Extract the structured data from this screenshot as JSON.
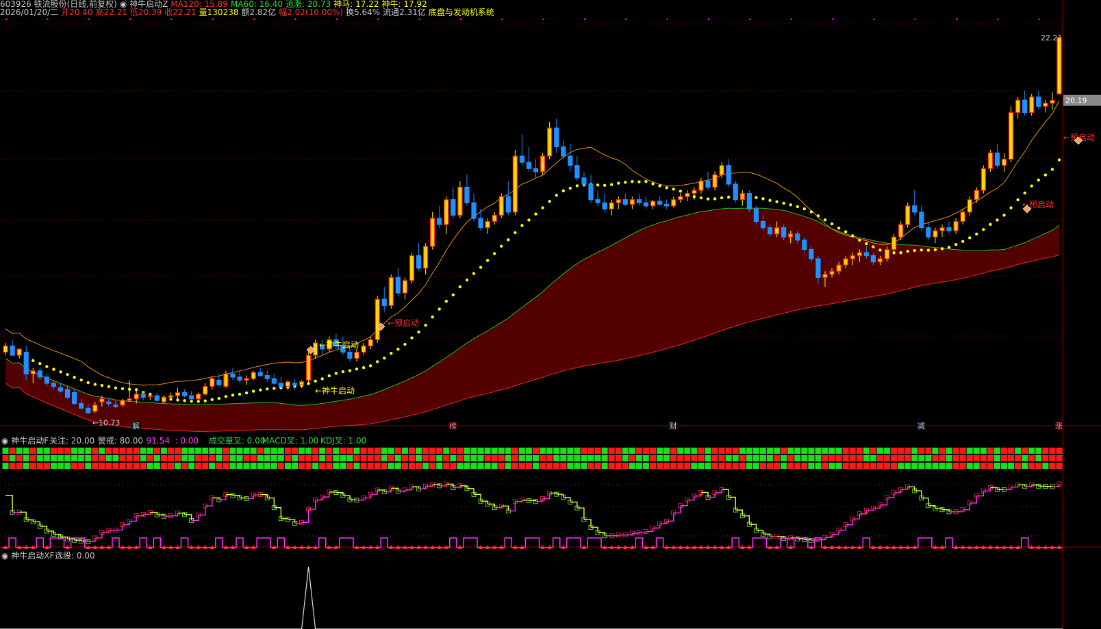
{
  "header": {
    "line1": [
      {
        "text": "603926 铁流股份(日线,前复权)",
        "color": "#c8c8c8"
      },
      {
        "text": "◉ 神牛启动Z",
        "color": "#c8c8c8"
      },
      {
        "text": "MA120: 15.89",
        "color": "#ff3333"
      },
      {
        "text": "MA60: 16.40",
        "color": "#33dd33"
      },
      {
        "text": "追涨: 20.73",
        "color": "#33dd33"
      },
      {
        "text": "神马: 17.22",
        "color": "#ffff00"
      },
      {
        "text": "神牛: 17.92",
        "color": "#ffff00"
      }
    ],
    "line2": [
      {
        "text": "2026/01/20/二",
        "color": "#c8c8c8"
      },
      {
        "text": "开20.40",
        "color": "#ff3333"
      },
      {
        "text": "高22.21",
        "color": "#ff3333"
      },
      {
        "text": "低20.39",
        "color": "#ff3333"
      },
      {
        "text": "收22.21",
        "color": "#ff3333"
      },
      {
        "text": "量130238",
        "color": "#ffff00"
      },
      {
        "text": "额2.82亿",
        "color": "#c8c8c8"
      },
      {
        "text": "幅2.02(10.00%)",
        "color": "#ff3333"
      },
      {
        "text": "换5.64%",
        "color": "#c8c8c8"
      },
      {
        "text": "流通2.31亿",
        "color": "#c8c8c8"
      },
      {
        "text": "底盘与发动机系统",
        "color": "#ffff00"
      }
    ]
  },
  "colors": {
    "up_body": "#ff2020",
    "up_fill": "#ffd700",
    "down": "#1e90ff",
    "grid": "#6b0000",
    "ma60": "#22c022",
    "ma120": "#ff2020",
    "band": "#520000",
    "orange": "#e8901a",
    "dots": "#ffff00",
    "wick": "#ffff00"
  },
  "chart_data": {
    "type": "candlestick",
    "price_labels": [
      "22.21",
      "20.19"
    ],
    "high_label": "22.21",
    "low_label": "←10.73",
    "annotations": [
      {
        "text": "←神牛启动",
        "color": "#ffff00",
        "at": "x≈16.5"
      },
      {
        "text": "←预启动",
        "color": "#ff3030",
        "at": "x≈44"
      },
      {
        "text": "←预启动",
        "color": "#ff3030",
        "at": "x≈145"
      },
      {
        "text": "←预启动",
        "color": "#ff3030",
        "at": "x≈152"
      },
      {
        "text": "←神牛启动",
        "color": "#ffff00",
        "at": "x≈44"
      }
    ],
    "event_marks": [
      {
        "text": "解",
        "color": "#7fd7ff",
        "i": 19
      },
      {
        "text": "榜",
        "color": "#ff8080",
        "i": 65
      },
      {
        "text": "财",
        "color": "#7fd7ff",
        "i": 97
      },
      {
        "text": "减",
        "color": "#7fd7ff",
        "i": 133
      },
      {
        "text": "涨",
        "color": "#ff8080",
        "i": 153
      }
    ],
    "ohlc": [
      [
        12.1,
        12.4,
        12.0,
        12.3
      ],
      [
        12.3,
        12.5,
        12.0,
        12.0
      ],
      [
        12.0,
        12.2,
        11.9,
        12.2
      ],
      [
        12.1,
        12.3,
        11.2,
        11.4
      ],
      [
        11.4,
        11.6,
        11.1,
        11.5
      ],
      [
        11.5,
        11.6,
        11.2,
        11.3
      ],
      [
        11.3,
        11.4,
        11.0,
        11.1
      ],
      [
        11.1,
        11.2,
        10.9,
        11.0
      ],
      [
        10.95,
        11.1,
        10.8,
        10.85
      ],
      [
        10.9,
        11.0,
        10.6,
        10.65
      ],
      [
        10.8,
        10.9,
        10.4,
        10.45
      ],
      [
        10.45,
        10.6,
        10.25,
        10.3
      ],
      [
        10.3,
        10.45,
        10.1,
        10.15
      ],
      [
        10.2,
        10.5,
        10.15,
        10.4
      ],
      [
        10.5,
        10.7,
        10.35,
        10.6
      ],
      [
        10.5,
        10.6,
        10.35,
        10.45
      ],
      [
        10.4,
        10.55,
        10.3,
        10.35
      ],
      [
        10.4,
        10.6,
        10.35,
        10.55
      ],
      [
        10.55,
        11.2,
        10.5,
        10.6
      ],
      [
        10.6,
        10.9,
        10.45,
        10.75
      ],
      [
        10.75,
        10.85,
        10.55,
        10.65
      ],
      [
        10.7,
        10.8,
        10.55,
        10.7
      ],
      [
        10.7,
        10.8,
        10.5,
        10.55
      ],
      [
        10.5,
        10.7,
        10.45,
        10.65
      ],
      [
        10.65,
        10.8,
        10.55,
        10.7
      ],
      [
        10.7,
        10.95,
        10.6,
        10.8
      ],
      [
        10.8,
        10.9,
        10.65,
        10.7
      ],
      [
        10.7,
        10.85,
        10.55,
        10.6
      ],
      [
        10.6,
        10.8,
        10.5,
        10.75
      ],
      [
        10.75,
        11.1,
        10.7,
        11.0
      ],
      [
        11.0,
        11.3,
        10.9,
        11.25
      ],
      [
        11.2,
        11.4,
        11.0,
        11.05
      ],
      [
        11.0,
        11.5,
        10.95,
        11.4
      ],
      [
        11.4,
        11.6,
        11.2,
        11.3
      ],
      [
        11.3,
        11.5,
        11.1,
        11.2
      ],
      [
        11.2,
        11.35,
        11.05,
        11.25
      ],
      [
        11.25,
        11.5,
        11.2,
        11.45
      ],
      [
        11.45,
        11.6,
        11.3,
        11.35
      ],
      [
        11.35,
        11.5,
        11.15,
        11.25
      ],
      [
        11.25,
        11.4,
        11.05,
        11.1
      ],
      [
        11.1,
        11.3,
        10.95,
        11.0
      ],
      [
        11.0,
        11.2,
        10.9,
        11.15
      ],
      [
        11.1,
        11.25,
        10.9,
        11.05
      ],
      [
        11.05,
        11.2,
        10.95,
        11.15
      ],
      [
        11.2,
        12.1,
        11.1,
        12.0
      ],
      [
        12.0,
        12.5,
        11.9,
        12.4
      ],
      [
        12.3,
        12.5,
        12.0,
        12.2
      ],
      [
        12.2,
        12.6,
        12.1,
        12.5
      ],
      [
        12.5,
        12.7,
        12.2,
        12.3
      ],
      [
        12.3,
        12.6,
        12.0,
        12.1
      ],
      [
        12.1,
        12.3,
        11.8,
        11.9
      ],
      [
        11.9,
        12.2,
        11.8,
        12.1
      ],
      [
        12.1,
        12.4,
        12.0,
        12.3
      ],
      [
        12.3,
        12.6,
        12.2,
        12.5
      ],
      [
        12.5,
        13.9,
        12.4,
        13.8
      ],
      [
        13.8,
        14.2,
        13.4,
        13.6
      ],
      [
        13.6,
        14.6,
        13.5,
        14.5
      ],
      [
        14.5,
        14.8,
        13.9,
        14.0
      ],
      [
        14.0,
        14.5,
        13.8,
        14.4
      ],
      [
        14.4,
        15.3,
        14.3,
        15.2
      ],
      [
        15.2,
        15.6,
        14.7,
        14.8
      ],
      [
        14.8,
        15.6,
        14.6,
        15.5
      ],
      [
        15.5,
        16.6,
        15.4,
        16.4
      ],
      [
        16.4,
        16.8,
        16.1,
        16.2
      ],
      [
        16.2,
        17.1,
        15.9,
        17.0
      ],
      [
        17.0,
        17.4,
        16.4,
        16.5
      ],
      [
        16.5,
        17.6,
        16.4,
        17.4
      ],
      [
        17.4,
        17.8,
        16.8,
        16.9
      ],
      [
        16.9,
        17.2,
        16.3,
        16.4
      ],
      [
        16.4,
        16.7,
        16.0,
        16.1
      ],
      [
        16.1,
        16.4,
        15.9,
        16.3
      ],
      [
        16.3,
        16.6,
        16.2,
        16.5
      ],
      [
        16.5,
        17.2,
        16.4,
        17.1
      ],
      [
        17.1,
        17.6,
        16.5,
        16.6
      ],
      [
        16.6,
        18.6,
        16.5,
        18.4
      ],
      [
        18.4,
        19.1,
        18.1,
        18.2
      ],
      [
        18.2,
        18.7,
        17.9,
        18.0
      ],
      [
        18.0,
        18.3,
        17.7,
        17.9
      ],
      [
        17.9,
        18.5,
        17.8,
        18.4
      ],
      [
        18.4,
        19.5,
        18.3,
        19.3
      ],
      [
        19.3,
        19.6,
        18.5,
        18.7
      ],
      [
        18.7,
        18.9,
        18.3,
        18.4
      ],
      [
        18.4,
        18.8,
        17.9,
        18.1
      ],
      [
        18.1,
        18.4,
        17.6,
        17.7
      ],
      [
        17.7,
        17.9,
        17.4,
        17.5
      ],
      [
        17.5,
        17.8,
        16.9,
        17.0
      ],
      [
        17.0,
        17.3,
        16.8,
        16.9
      ],
      [
        16.9,
        17.2,
        16.6,
        16.7
      ],
      [
        16.7,
        17.0,
        16.5,
        16.9
      ],
      [
        16.9,
        17.1,
        16.7,
        17.0
      ],
      [
        17.0,
        17.2,
        16.8,
        16.85
      ],
      [
        16.85,
        17.1,
        16.7,
        17.0
      ],
      [
        17.0,
        17.2,
        16.8,
        16.9
      ],
      [
        16.9,
        17.1,
        16.7,
        16.8
      ],
      [
        16.8,
        17.0,
        16.7,
        16.95
      ],
      [
        16.95,
        17.1,
        16.8,
        16.85
      ],
      [
        16.85,
        17.0,
        16.7,
        16.8
      ],
      [
        16.8,
        17.1,
        16.75,
        17.0
      ],
      [
        17.0,
        17.2,
        16.9,
        17.1
      ],
      [
        17.1,
        17.3,
        16.95,
        17.2
      ],
      [
        17.2,
        17.4,
        17.0,
        17.3
      ],
      [
        17.3,
        17.7,
        17.2,
        17.6
      ],
      [
        17.6,
        17.9,
        17.3,
        17.4
      ],
      [
        17.4,
        17.9,
        17.3,
        17.8
      ],
      [
        17.8,
        18.2,
        17.7,
        18.1
      ],
      [
        18.1,
        18.3,
        17.4,
        17.5
      ],
      [
        17.5,
        17.6,
        16.9,
        17.0
      ],
      [
        17.0,
        17.3,
        16.8,
        17.2
      ],
      [
        17.2,
        17.3,
        16.6,
        16.7
      ],
      [
        16.7,
        16.8,
        16.2,
        16.3
      ],
      [
        16.3,
        16.5,
        16.0,
        16.1
      ],
      [
        16.1,
        16.2,
        15.8,
        15.9
      ],
      [
        15.9,
        16.3,
        15.8,
        16.1
      ],
      [
        16.1,
        16.2,
        15.7,
        15.8
      ],
      [
        15.8,
        16.0,
        15.6,
        15.9
      ],
      [
        15.9,
        16.0,
        15.6,
        15.7
      ],
      [
        15.7,
        15.8,
        15.3,
        15.4
      ],
      [
        15.4,
        15.5,
        15.0,
        15.1
      ],
      [
        15.1,
        15.2,
        14.3,
        14.5
      ],
      [
        14.5,
        14.7,
        14.2,
        14.6
      ],
      [
        14.6,
        14.8,
        14.5,
        14.7
      ],
      [
        14.7,
        15.0,
        14.6,
        14.9
      ],
      [
        14.9,
        15.2,
        14.8,
        15.1
      ],
      [
        15.1,
        15.3,
        14.9,
        15.2
      ],
      [
        15.2,
        15.4,
        15.0,
        15.3
      ],
      [
        15.3,
        15.5,
        15.1,
        15.2
      ],
      [
        15.2,
        15.3,
        14.9,
        15.0
      ],
      [
        15.0,
        15.2,
        14.9,
        15.1
      ],
      [
        15.1,
        15.5,
        15.0,
        15.4
      ],
      [
        15.4,
        15.9,
        15.3,
        15.8
      ],
      [
        15.8,
        16.3,
        15.7,
        16.2
      ],
      [
        16.2,
        16.9,
        16.1,
        16.8
      ],
      [
        16.8,
        17.3,
        16.5,
        16.6
      ],
      [
        16.6,
        16.8,
        16.0,
        16.1
      ],
      [
        16.1,
        16.3,
        15.7,
        15.8
      ],
      [
        15.8,
        16.1,
        15.6,
        16.0
      ],
      [
        16.0,
        16.2,
        15.8,
        16.1
      ],
      [
        16.1,
        16.3,
        15.9,
        16.0
      ],
      [
        16.0,
        16.4,
        15.9,
        16.3
      ],
      [
        16.3,
        16.7,
        16.2,
        16.6
      ],
      [
        16.6,
        17.1,
        16.5,
        17.0
      ],
      [
        17.0,
        17.4,
        16.9,
        17.3
      ],
      [
        17.3,
        18.1,
        17.2,
        18.0
      ],
      [
        18.0,
        18.6,
        17.9,
        18.5
      ],
      [
        18.5,
        18.8,
        18.0,
        18.1
      ],
      [
        18.1,
        18.5,
        17.9,
        18.3
      ],
      [
        18.3,
        20.0,
        18.2,
        19.8
      ],
      [
        19.8,
        20.3,
        19.6,
        20.2
      ],
      [
        20.2,
        20.5,
        19.7,
        19.8
      ],
      [
        19.8,
        20.4,
        19.7,
        20.3
      ],
      [
        20.3,
        20.5,
        19.9,
        20.0
      ],
      [
        20.0,
        20.2,
        19.8,
        20.1
      ],
      [
        20.1,
        20.45,
        19.9,
        20.19
      ],
      [
        20.4,
        22.21,
        20.39,
        22.21
      ]
    ],
    "ylim": [
      10.0,
      22.8
    ],
    "indicator1": {
      "label": "◉ 神牛启动F",
      "values": [
        {
          "text": "关注: 20.00",
          "color": "#c8c8c8"
        },
        {
          "text": "警戒: 80.00",
          "color": "#c8c8c8"
        },
        {
          "text": "91.54",
          "color": "#ff40ff"
        },
        {
          "text": ": 0.00",
          "color": "#ff40ff"
        },
        {
          "text": "成交量叉: 0.00",
          "color": "#33dd33"
        },
        {
          "text": "MACD叉: 1.00",
          "color": "#33dd33"
        },
        {
          "text": "KDJ叉: 1.00",
          "color": "#33dd33"
        }
      ]
    },
    "indicator2": {
      "label": "◉ 神牛启动XF",
      "values": [
        {
          "text": "选股: 0.00",
          "color": "#c8c8c8"
        }
      ],
      "spike_index": 44,
      "ylim": [
        0,
        1
      ]
    }
  }
}
